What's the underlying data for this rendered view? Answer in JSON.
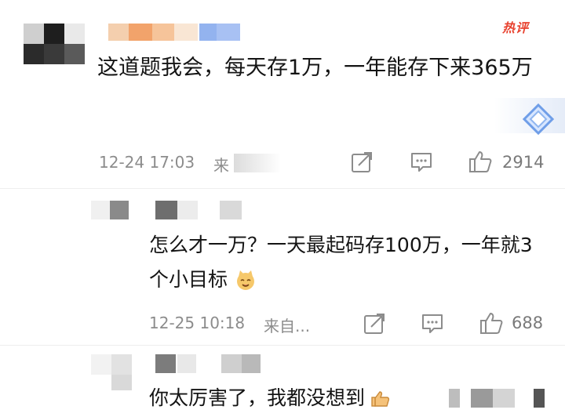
{
  "hot_badge": "热评",
  "comments": [
    {
      "text": "这道题我会，每天存1万，一年能存下来365万",
      "time": "12-24 17:03",
      "source": "来",
      "reply_count_icon": "comment-icon",
      "likes": "2914"
    },
    {
      "text": "怎么才一万？一天最起码存100万，一年就3个小目标",
      "time": "12-25 10:18",
      "source": "来自...",
      "likes": "688"
    },
    {
      "text": "你太厉害了，我都没想到"
    }
  ],
  "icons": {
    "share": "share-icon",
    "comment": "comment-icon",
    "like": "thumbs-up-icon",
    "emoji_cat": "cat-emoji-icon",
    "emoji_thumb": "thumbs-up-emoji-icon",
    "decoration": "diamond-icon"
  },
  "colors": {
    "hot": "#e8422f",
    "text": "#141414",
    "meta": "#8c8c8c"
  }
}
